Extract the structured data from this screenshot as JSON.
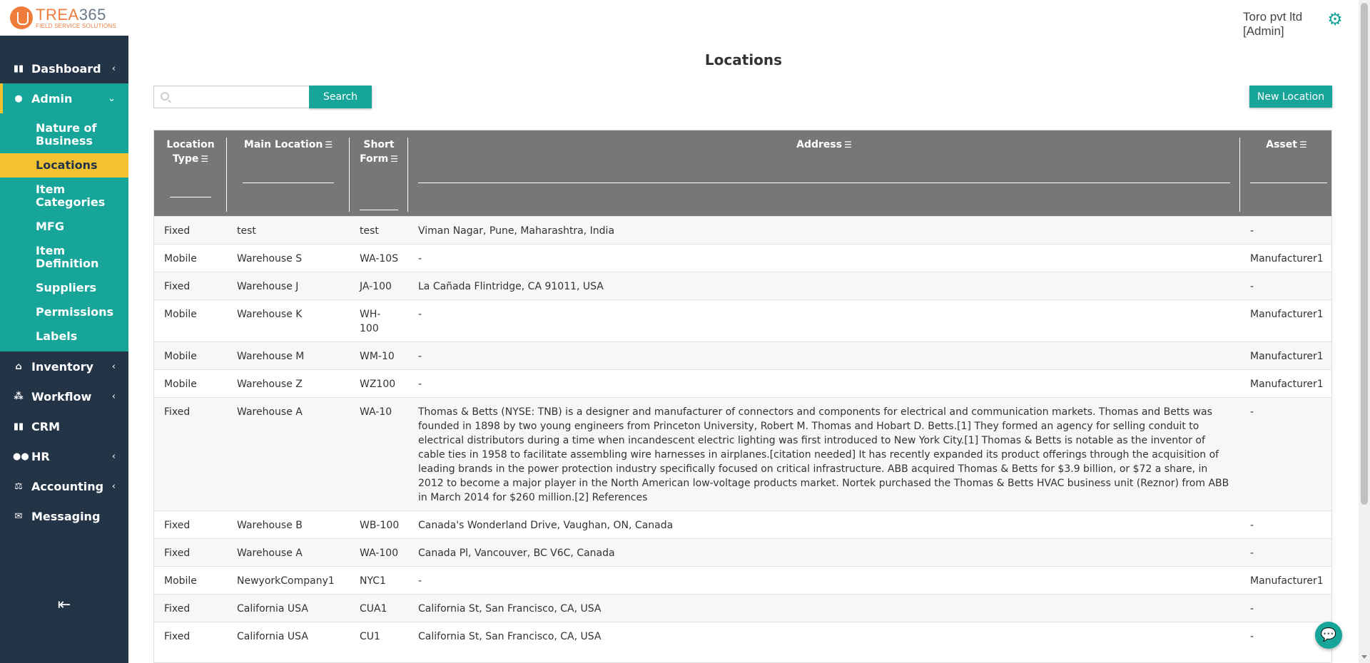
{
  "brand": {
    "name_main": "TREA",
    "name_num": "365",
    "tagline": "FIELD SERVICE SOLUTIONS"
  },
  "user": {
    "company": "Toro pvt ltd",
    "role": "[Admin]"
  },
  "sidebar": {
    "items": [
      {
        "label": "Dashboard",
        "icon": "bar-chart-icon",
        "chevron": "‹"
      },
      {
        "label": "Admin",
        "icon": "user-icon",
        "chevron": "⌄"
      },
      {
        "label": "Inventory",
        "icon": "home-icon",
        "chevron": "‹"
      },
      {
        "label": "Workflow",
        "icon": "workflow-icon",
        "chevron": "‹"
      },
      {
        "label": "CRM",
        "icon": "bar-chart-icon",
        "chevron": ""
      },
      {
        "label": "HR",
        "icon": "people-icon",
        "chevron": "‹"
      },
      {
        "label": "Accounting",
        "icon": "balance-icon",
        "chevron": "‹"
      },
      {
        "label": "Messaging",
        "icon": "chat-icon",
        "chevron": ""
      }
    ],
    "admin_sub": [
      "Nature of Business",
      "Locations",
      "Item Categories",
      "MFG",
      "Item Definition",
      "Suppliers",
      "Permissions",
      "Labels"
    ],
    "collapse_icon": "collapse-left-icon"
  },
  "page": {
    "title": "Locations"
  },
  "search": {
    "placeholder": "",
    "button": "Search"
  },
  "new_button": "New Location",
  "table": {
    "headers": [
      "Location Type",
      "Main Location",
      "Short Form",
      "Address",
      "Asset"
    ],
    "rows": [
      [
        "Fixed",
        "test",
        "test",
        "Viman Nagar, Pune, Maharashtra, India",
        "-"
      ],
      [
        "Mobile",
        "Warehouse S",
        "WA-10S",
        "-",
        "Manufacturer1"
      ],
      [
        "Fixed",
        "Warehouse J",
        "JA-100",
        "La Cañada Flintridge, CA 91011, USA",
        "-"
      ],
      [
        "Mobile",
        "Warehouse K",
        "WH-100",
        "-",
        "Manufacturer1"
      ],
      [
        "Mobile",
        "Warehouse M",
        "WM-10",
        "-",
        "Manufacturer1"
      ],
      [
        "Mobile",
        "Warehouse Z",
        "WZ100",
        "-",
        "Manufacturer1"
      ],
      [
        "Fixed",
        "Warehouse A",
        "WA-10",
        "Thomas & Betts (NYSE: TNB) is a designer and manufacturer of connectors and components for electrical and communication markets. Thomas and Betts was founded in 1898 by two young engineers from Princeton University, Robert M. Thomas and Hobart D. Betts.[1] They formed an agency for selling conduit to electrical distributors during a time when incandescent electric lighting was first introduced to New York City.[1] Thomas & Betts is notable as the inventor of cable ties in 1958 to facilitate assembling wire harnesses in airplanes.[citation needed] It has recently expanded its product offerings through the acquisition of leading brands in the power protection industry specifically focused on critical infrastructure. ABB acquired Thomas & Betts for $3.9 billion, or $72 a share, in 2012 to become a major player in the North American low-voltage products market. Nortek purchased the Thomas & Betts HVAC business unit (Reznor) from ABB in March 2014 for $260 million.[2] References",
        "-"
      ],
      [
        "Fixed",
        "Warehouse B",
        "WB-100",
        "Canada's Wonderland Drive, Vaughan, ON, Canada",
        "-"
      ],
      [
        "Fixed",
        "Warehouse A",
        "WA-100",
        "Canada Pl, Vancouver, BC V6C, Canada",
        "-"
      ],
      [
        "Mobile",
        "NewyorkCompany1",
        "NYC1",
        "-",
        "Manufacturer1"
      ],
      [
        "Fixed",
        "California USA",
        "CUA1",
        "California St, San Francisco, CA, USA",
        "-"
      ],
      [
        "Fixed",
        "California USA",
        "CU1",
        "California St, San Francisco, CA, USA",
        "-"
      ]
    ]
  },
  "colors": {
    "sidebar_bg": "#243447",
    "accent": "#17a59a",
    "highlight": "#f2c230",
    "header_bg": "#777777",
    "brand_orange": "#f07c3c"
  }
}
